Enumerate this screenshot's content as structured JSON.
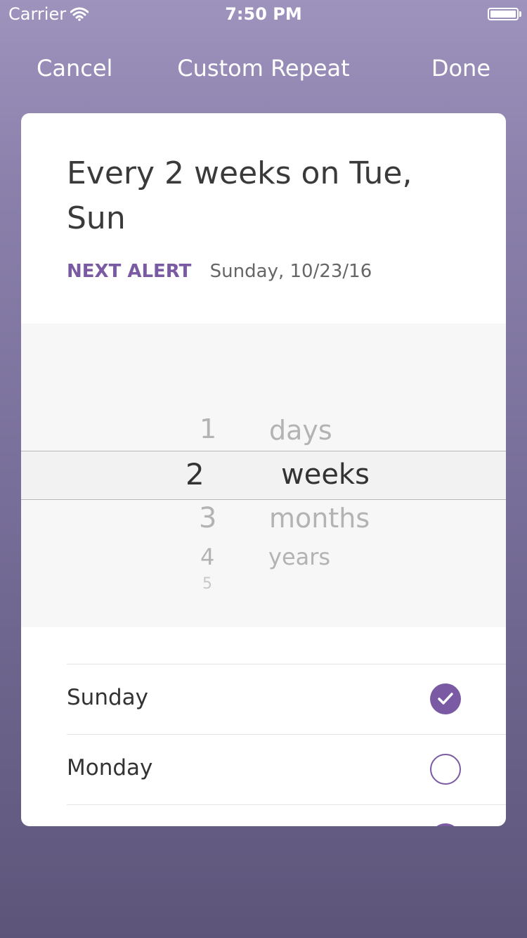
{
  "status_bar": {
    "carrier": "Carrier",
    "time": "7:50 PM",
    "wifi_icon": "wifi-icon",
    "battery_icon": "battery-icon"
  },
  "nav": {
    "cancel_label": "Cancel",
    "title": "Custom Repeat",
    "done_label": "Done"
  },
  "summary": {
    "text": "Every 2 weeks on Tue, Sun"
  },
  "next_alert": {
    "label": "NEXT ALERT",
    "value": "Sunday, 10/23/16"
  },
  "picker": {
    "numbers": {
      "above": "1",
      "selected": "2",
      "below": [
        "3",
        "4",
        "5"
      ]
    },
    "units": {
      "above": "days",
      "selected": "weeks",
      "below": [
        "months",
        "years"
      ]
    }
  },
  "days": [
    {
      "label": "Sunday",
      "checked": true
    },
    {
      "label": "Monday",
      "checked": false
    }
  ],
  "colors": {
    "accent": "#7a5aa3",
    "background_top": "#9d93bd",
    "background_bottom": "#5d5579"
  }
}
